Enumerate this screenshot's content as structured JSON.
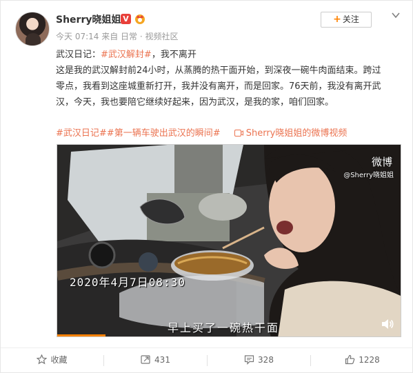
{
  "post": {
    "username": "Sherry晓姐姐",
    "vip_badge": "V",
    "meta": "今天 07:14 来自 日常 · 视频社区",
    "follow_label": "关注",
    "text_line1_prefix": "武汉日记：",
    "text_line1_hashtag": "#武汉解封#",
    "text_line1_suffix": "，我不离开",
    "text_body": "这是我的武汉解封前24小时，从蒸腾的热干面开始，到深夜一碗牛肉面结束。跨过零点，我看到这座城重新打开，我并没有离开，而是回家。76天前，我没有离开武汉，今天，我也要陪它继续好起来，因为武汉，是我的家，咱们回家。",
    "topic_1": "#武汉日记#",
    "topic_2": "#第一辆车驶出武汉的瞬间#",
    "video_link": "Sherry晓姐姐的微博视频"
  },
  "video": {
    "watermark_logo": "微博",
    "watermark_user": "@Sherry晓姐姐",
    "timestamp": "2020年4月7日08:30",
    "subtitle": "早上买了一碗热干面",
    "progress_fraction": 0.14
  },
  "actions": {
    "favorite_label": "收藏",
    "forward_count": "431",
    "comment_count": "328",
    "like_count": "1228"
  },
  "colors": {
    "accent": "#ff8200",
    "hashtag": "#eb7350",
    "vip": "#e8403a"
  }
}
